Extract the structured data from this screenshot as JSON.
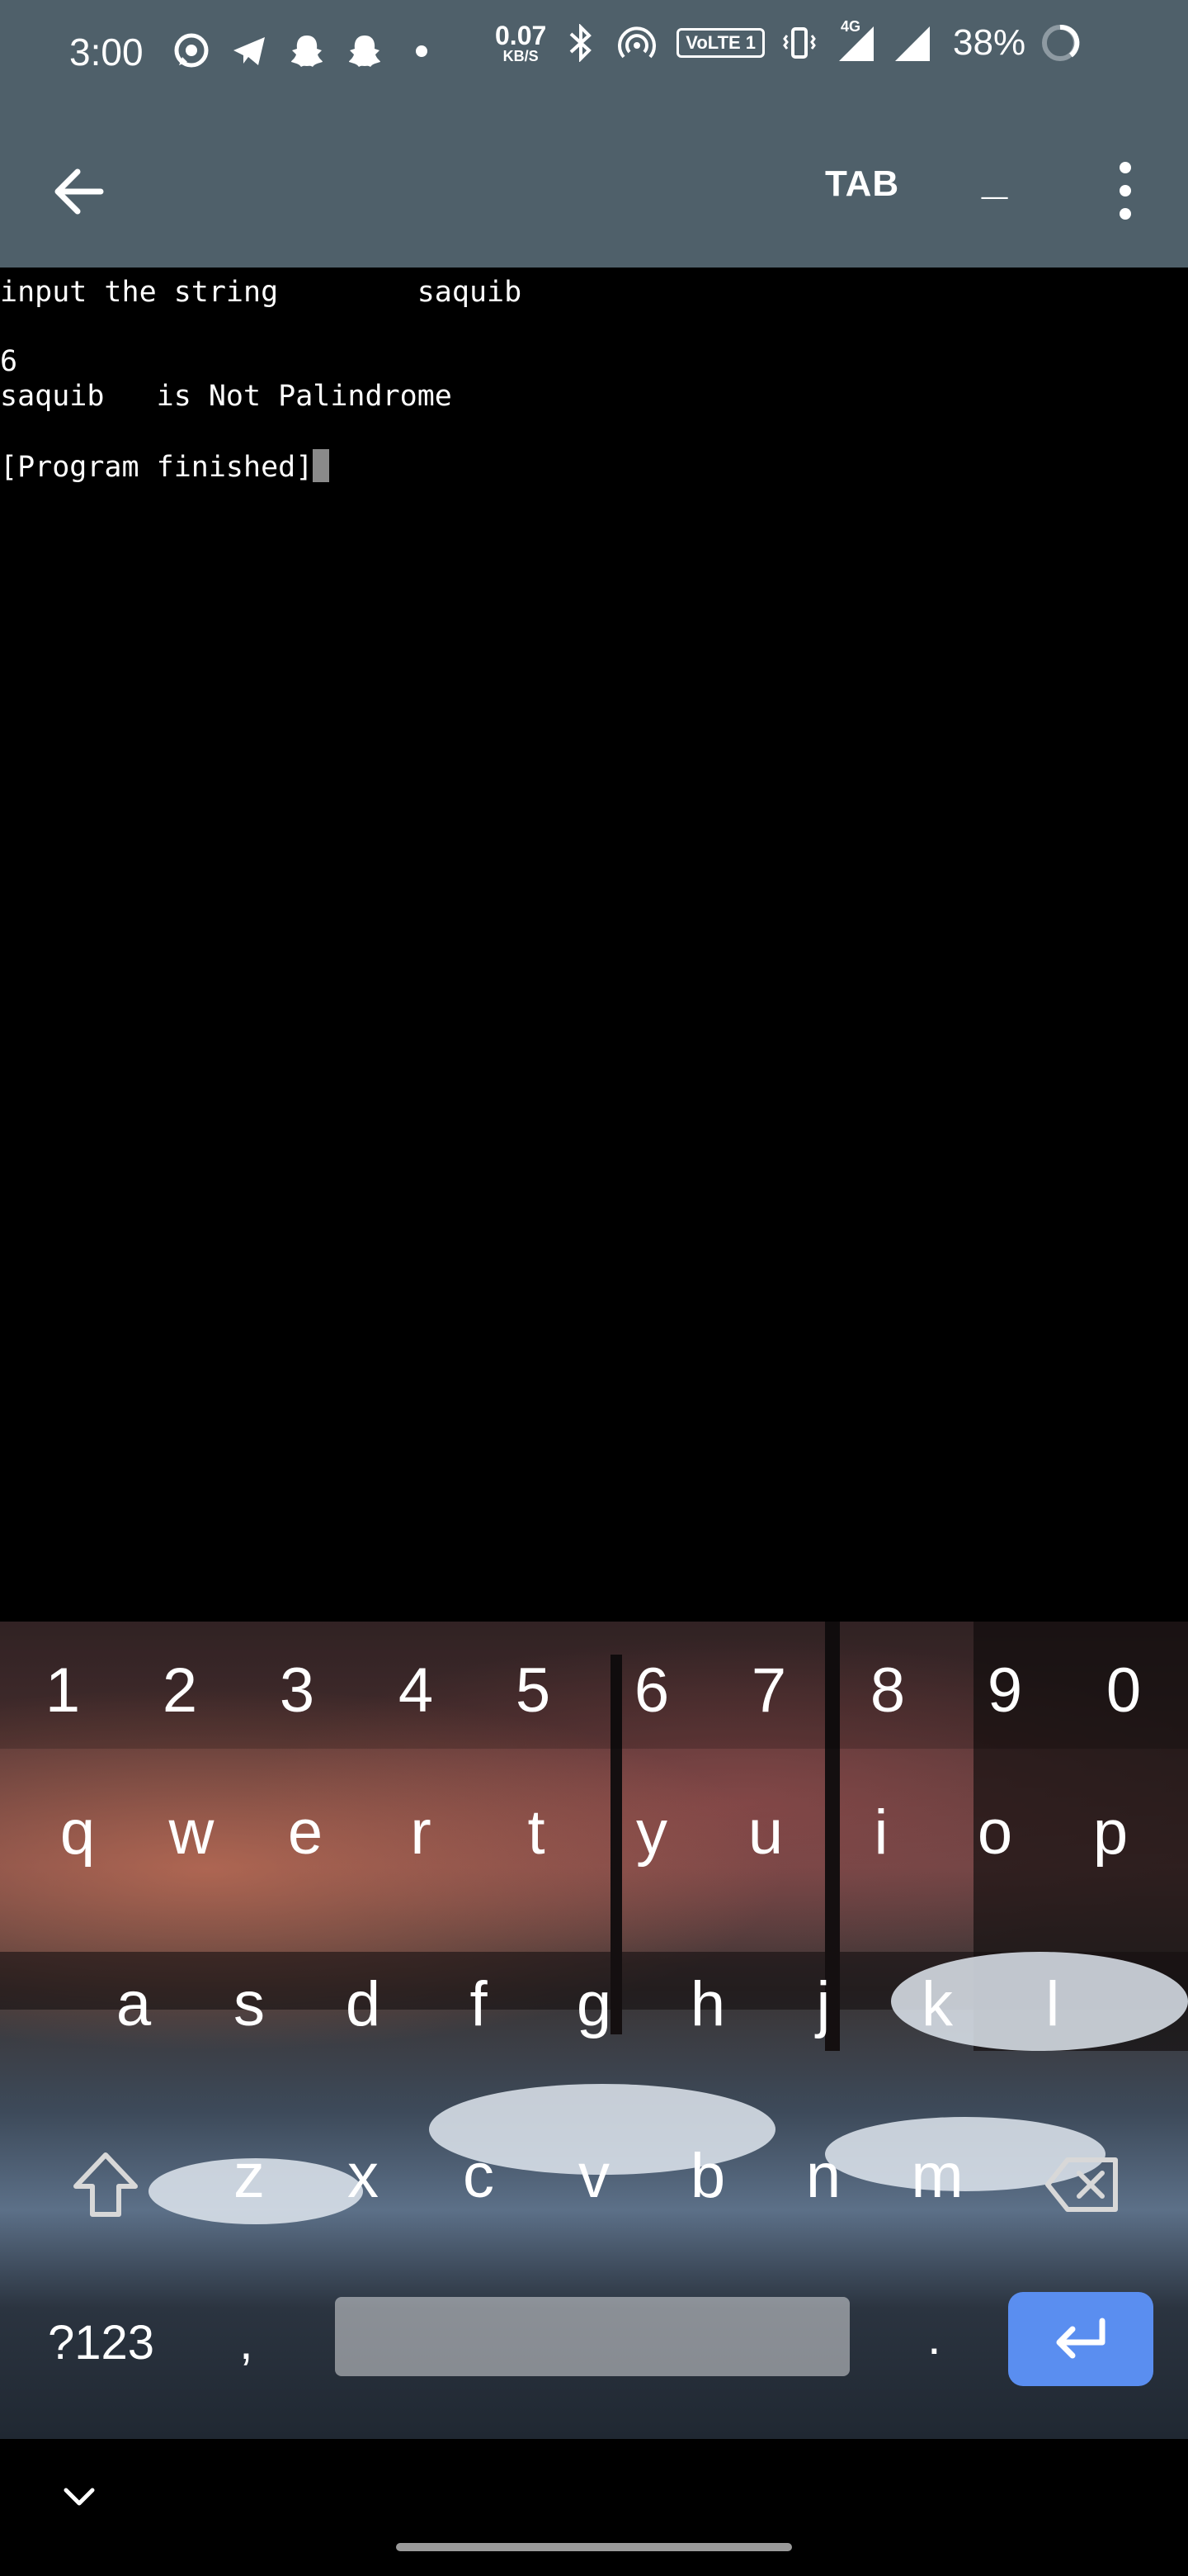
{
  "status_bar": {
    "time": "3:00",
    "net_speed_value": "0.07",
    "net_speed_unit": "KB/S",
    "volte_label": "VoLTE 1",
    "network_type": "4G",
    "battery": "38%"
  },
  "toolbar": {
    "tab_label": "TAB",
    "underscore_label": "_"
  },
  "terminal": {
    "line1": "input the string        saquib",
    "line2": "6",
    "line3": "saquib   is Not Palindrome",
    "line4": "[Program finished]"
  },
  "keyboard": {
    "number_row": [
      "1",
      "2",
      "3",
      "4",
      "5",
      "6",
      "7",
      "8",
      "9",
      "0"
    ],
    "row1": [
      "q",
      "w",
      "e",
      "r",
      "t",
      "y",
      "u",
      "i",
      "o",
      "p"
    ],
    "row2": [
      "a",
      "s",
      "d",
      "f",
      "g",
      "h",
      "j",
      "k",
      "l"
    ],
    "row3": [
      "z",
      "x",
      "c",
      "v",
      "b",
      "n",
      "m"
    ],
    "symbols_label": "?123",
    "comma_label": ",",
    "period_label": ".",
    "enter_color": "#5a8ef0"
  },
  "colors": {
    "toolbar_bg": "#4f606a",
    "terminal_bg": "#000000",
    "terminal_text": "#ffffff",
    "cursor": "#8a8a8a"
  }
}
